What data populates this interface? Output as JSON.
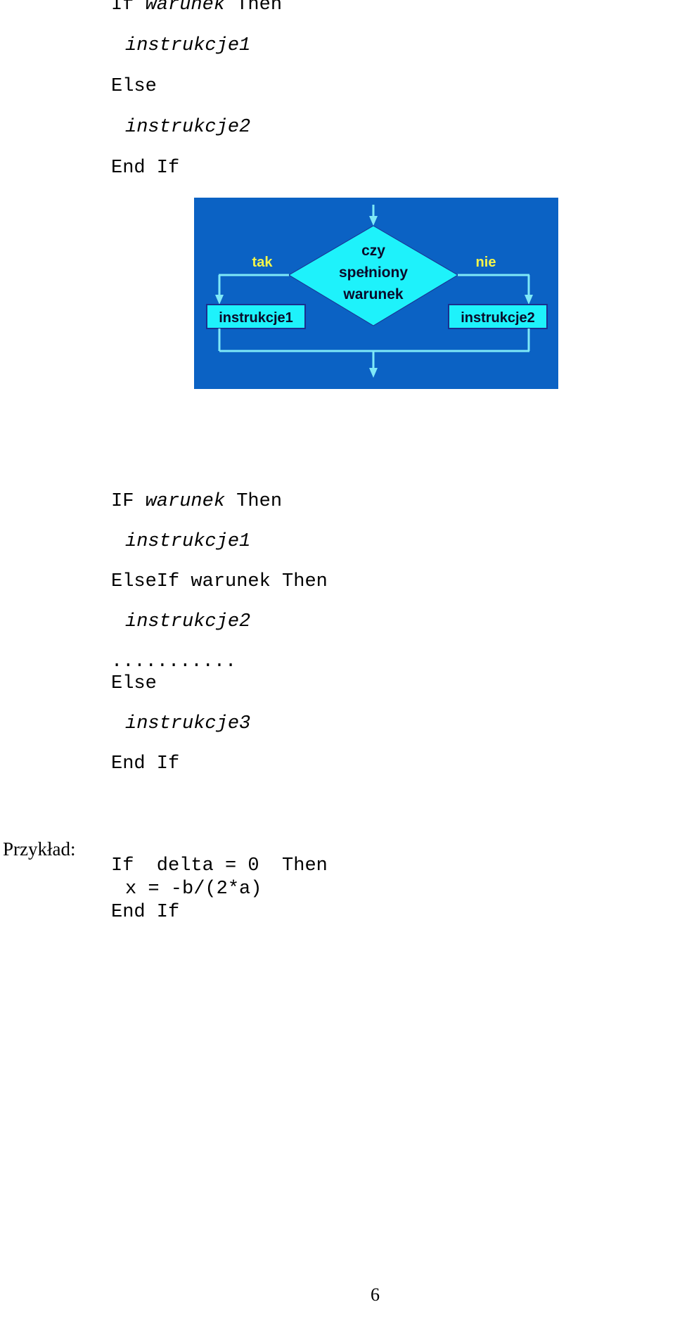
{
  "document": {
    "language": "pl",
    "page_number": "6"
  },
  "listing_top": {
    "lines": [
      {
        "indent": 0,
        "parts": [
          {
            "text": "If ",
            "style": "normal"
          },
          {
            "text": "warunek",
            "style": "italic"
          },
          {
            "text": " Then",
            "style": "normal"
          }
        ]
      },
      {
        "indent": 1,
        "parts": [
          {
            "text": "instrukcje1",
            "style": "italic"
          }
        ]
      },
      {
        "indent": 0,
        "parts": [
          {
            "text": "Else",
            "style": "normal"
          }
        ]
      },
      {
        "indent": 1,
        "parts": [
          {
            "text": "instrukcje2",
            "style": "italic"
          }
        ]
      },
      {
        "indent": 0,
        "parts": [
          {
            "text": "End If",
            "style": "normal"
          }
        ]
      }
    ]
  },
  "listing_elseif": {
    "lines": [
      {
        "indent": 0,
        "parts": [
          {
            "text": "IF ",
            "style": "normal"
          },
          {
            "text": "warunek",
            "style": "italic"
          },
          {
            "text": " Then",
            "style": "normal"
          }
        ]
      },
      {
        "indent": 1,
        "parts": [
          {
            "text": "instrukcje1",
            "style": "italic"
          }
        ]
      },
      {
        "indent": 0,
        "parts": [
          {
            "text": "ElseIf warunek Then",
            "style": "normal"
          }
        ]
      },
      {
        "indent": 1,
        "parts": [
          {
            "text": "instrukcje2",
            "style": "italic"
          }
        ]
      },
      {
        "indent": 0,
        "parts": [
          {
            "text": "...........",
            "style": "normal"
          }
        ],
        "tight": true
      },
      {
        "indent": 0,
        "parts": [
          {
            "text": "Else",
            "style": "normal"
          }
        ]
      },
      {
        "indent": 1,
        "parts": [
          {
            "text": "instrukcje3",
            "style": "italic"
          }
        ]
      },
      {
        "indent": 0,
        "parts": [
          {
            "text": "End If",
            "style": "normal"
          }
        ]
      }
    ]
  },
  "przyklad": {
    "label": "Przykład:"
  },
  "listing_example": {
    "lines": [
      {
        "indent": 0,
        "parts": [
          {
            "text": "If  delta = 0  Then",
            "style": "normal"
          }
        ]
      },
      {
        "indent": 1,
        "parts": [
          {
            "text": "x = -b/(2*a)",
            "style": "normal"
          }
        ]
      },
      {
        "indent": 0,
        "parts": [
          {
            "text": "End If",
            "style": "normal"
          }
        ]
      }
    ]
  },
  "figure": {
    "alt_name": "if-then-else-flowchart",
    "colors": {
      "background": "#0b62c4",
      "shape_fill": "#1ef2fb",
      "shape_stroke": "#1b2f8f",
      "connector": "#7fe9f7",
      "label_yes_no": "#f5f54a",
      "text": "#0a0a2a"
    },
    "decision": {
      "name": "decision-diamond",
      "lines": [
        "czy",
        "spełniony",
        "warunek"
      ]
    },
    "branch_labels": {
      "yes": "tak",
      "no": "nie"
    },
    "boxes": [
      {
        "name": "process-box-true",
        "label": "instrukcje1"
      },
      {
        "name": "process-box-false",
        "label": "instrukcje2"
      }
    ]
  }
}
